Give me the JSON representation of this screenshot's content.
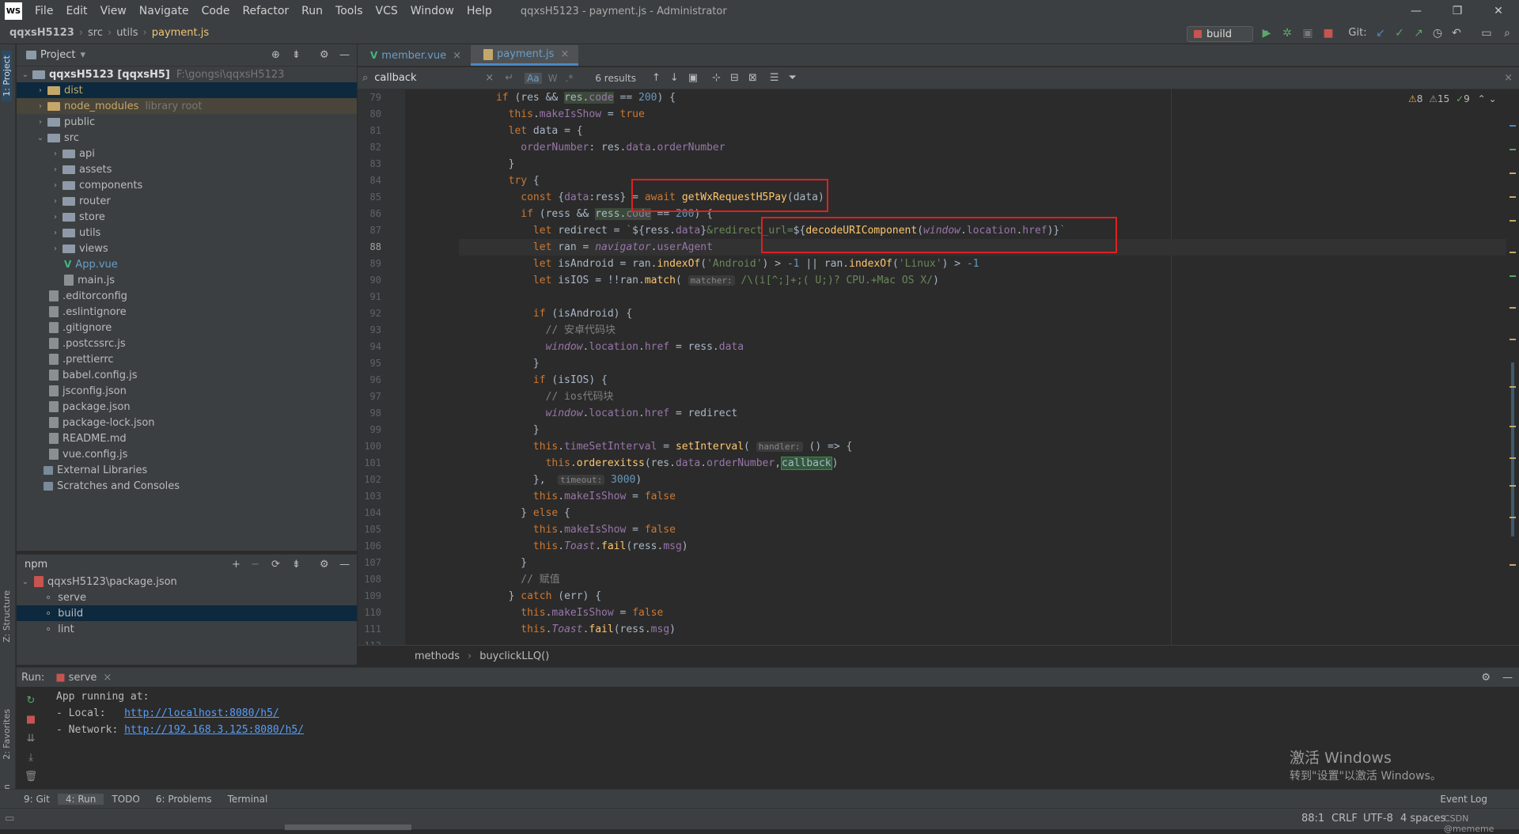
{
  "app": {
    "logo": "WS",
    "title": "qqxsH5123 - payment.js - Administrator",
    "menu": [
      "File",
      "Edit",
      "View",
      "Navigate",
      "Code",
      "Refactor",
      "Run",
      "Tools",
      "VCS",
      "Window",
      "Help"
    ]
  },
  "nav": {
    "project": "qqxsH5123",
    "crumbs": [
      "src",
      "utils",
      "payment.js"
    ]
  },
  "toolbar": {
    "run_config": "build",
    "git_label": "Git:"
  },
  "project": {
    "header": "Project",
    "root": "qqxsH5123 [qqxsH5]",
    "root_path": "F:\\gongsi\\qqxsH5123",
    "items": [
      {
        "label": "dist",
        "type": "folder-y",
        "indent": 1,
        "arrow": "›"
      },
      {
        "label": "node_modules",
        "hint": "library root",
        "type": "folder-y",
        "indent": 1,
        "arrow": "›"
      },
      {
        "label": "public",
        "type": "folder",
        "indent": 1,
        "arrow": "›"
      },
      {
        "label": "src",
        "type": "folder",
        "indent": 1,
        "arrow": "⌄"
      },
      {
        "label": "api",
        "type": "folder",
        "indent": 2,
        "arrow": "›"
      },
      {
        "label": "assets",
        "type": "folder",
        "indent": 2,
        "arrow": "›"
      },
      {
        "label": "components",
        "type": "folder",
        "indent": 2,
        "arrow": "›"
      },
      {
        "label": "router",
        "type": "folder",
        "indent": 2,
        "arrow": "›"
      },
      {
        "label": "store",
        "type": "folder",
        "indent": 2,
        "arrow": "›"
      },
      {
        "label": "utils",
        "type": "folder",
        "indent": 2,
        "arrow": "›"
      },
      {
        "label": "views",
        "type": "folder",
        "indent": 2,
        "arrow": "›"
      },
      {
        "label": "App.vue",
        "type": "vue",
        "indent": 2
      },
      {
        "label": "main.js",
        "type": "file",
        "indent": 2
      },
      {
        "label": ".editorconfig",
        "type": "file",
        "indent": 1
      },
      {
        "label": ".eslintignore",
        "type": "file",
        "indent": 1
      },
      {
        "label": ".gitignore",
        "type": "file",
        "indent": 1
      },
      {
        "label": ".postcssrc.js",
        "type": "file",
        "indent": 1
      },
      {
        "label": ".prettierrc",
        "type": "file",
        "indent": 1
      },
      {
        "label": "babel.config.js",
        "type": "file",
        "indent": 1
      },
      {
        "label": "jsconfig.json",
        "type": "file",
        "indent": 1
      },
      {
        "label": "package.json",
        "type": "file",
        "indent": 1
      },
      {
        "label": "package-lock.json",
        "type": "file",
        "indent": 1
      },
      {
        "label": "README.md",
        "type": "file",
        "indent": 1
      },
      {
        "label": "vue.config.js",
        "type": "file",
        "indent": 1
      },
      {
        "label": "External Libraries",
        "type": "lib",
        "indent": 0
      },
      {
        "label": "Scratches and Consoles",
        "type": "lib",
        "indent": 0
      }
    ]
  },
  "npm": {
    "header": "npm",
    "root": "qqxsH5123\\package.json",
    "scripts": [
      "serve",
      "build",
      "lint"
    ],
    "selected": "build"
  },
  "editor": {
    "tabs": [
      "member.vue",
      "payment.js"
    ],
    "active_tab": "payment.js",
    "search_query": "callback",
    "results": "6 results",
    "warnings": {
      "warn": "8",
      "weak": "15",
      "ok": "9"
    },
    "line_numbers": [
      "79",
      "80",
      "81",
      "82",
      "83",
      "84",
      "85",
      "86",
      "87",
      "88",
      "89",
      "90",
      "91",
      "92",
      "93",
      "94",
      "95",
      "96",
      "97",
      "98",
      "99",
      "100",
      "101",
      "102",
      "103",
      "104",
      "105",
      "106",
      "107",
      "108",
      "109",
      "110",
      "111",
      "112"
    ],
    "breadcrumb": [
      "methods",
      "buyclickLLQ()"
    ]
  },
  "run": {
    "label": "Run:",
    "config": "serve",
    "lines": [
      "App running at:",
      "- Local:   ",
      "- Network: "
    ],
    "local_url": "http://localhost:8080/h5/",
    "network_url": "http://192.168.3.125:8080/h5/"
  },
  "watermark": {
    "line1": "激活 Windows",
    "line2": "转到\"设置\"以激活 Windows。"
  },
  "toolwindows": [
    "9: Git",
    "4: Run",
    "TODO",
    "6: Problems",
    "Terminal"
  ],
  "event_log": "Event Log",
  "status": {
    "position": "88:1",
    "line_sep": "CRLF",
    "encoding": "UTF-8",
    "indent": "4 spaces",
    "watermark": "CSDN @mememe"
  },
  "side_tabs": {
    "project": "1: Project",
    "structure": "Z: Structure",
    "favorites": "2: Favorites",
    "npm": "npm"
  }
}
